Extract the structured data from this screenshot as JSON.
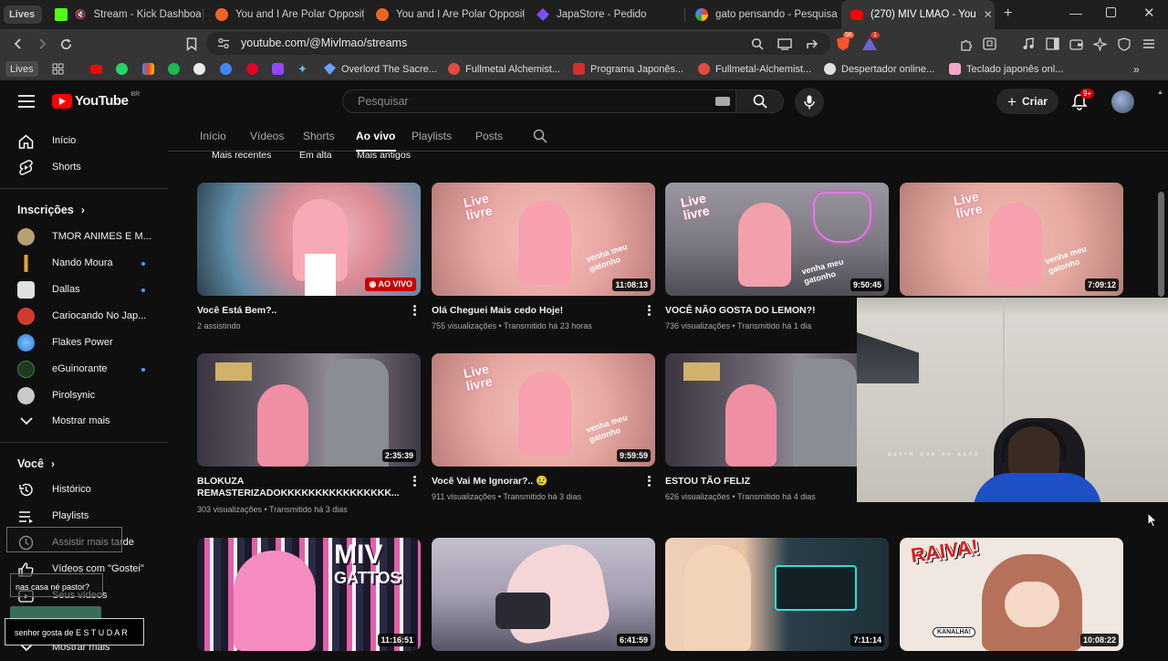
{
  "browser": {
    "tabs": [
      {
        "title": "Lives",
        "color": "#4a4a4a"
      },
      {
        "title": "Stream - Kick Dashboar",
        "color": "#53fc18"
      },
      {
        "title": "You and I Are Polar Opposit",
        "color": "#f16322"
      },
      {
        "title": "You and I Are Polar Opposit",
        "color": "#f16322"
      },
      {
        "title": "JapaStore - Pedido",
        "color": "#7b4dff"
      },
      {
        "title": "gato pensando - Pesquisa G",
        "color": "#ffffff"
      },
      {
        "title": "(270) MIV LMAO - You",
        "color": "#ff0000"
      }
    ],
    "url": "youtube.com/@Mivlmao/streams",
    "shield_badge": "1",
    "bookmarks": [
      {
        "label": "Lives"
      },
      {
        "label": "Overlord The Sacre..."
      },
      {
        "label": "Fullmetal Alchemist..."
      },
      {
        "label": "Programa Japonês..."
      },
      {
        "label": "Fullmetal-Alchemist..."
      },
      {
        "label": "Despertador online..."
      },
      {
        "label": "Teclado japonês onl..."
      }
    ]
  },
  "masthead": {
    "logo_text": "YouTube",
    "region": "BR",
    "search_placeholder": "Pesquisar",
    "create_label": "Criar",
    "notif_count": "9+"
  },
  "sidebar": {
    "home": "Início",
    "shorts": "Shorts",
    "subs_heading": "Inscrições",
    "subscriptions": [
      {
        "name": "TMOR ANIMES E M...",
        "color": "#b8a070",
        "dot": false
      },
      {
        "name": "Nando Moura",
        "color": "#0f0f0f",
        "dot": true
      },
      {
        "name": "Dallas",
        "color": "#e0e0e0",
        "dot": true
      },
      {
        "name": "Cariocando No Jap...",
        "color": "#d13b2e",
        "dot": false
      },
      {
        "name": "Flakes Power",
        "color": "#2b7bd8",
        "dot": false
      },
      {
        "name": "eGuinorante",
        "color": "#1f3a1f",
        "dot": true
      },
      {
        "name": "Pirolsynic",
        "color": "#c9c9c9",
        "dot": false
      }
    ],
    "show_more": "Mostrar mais",
    "you_heading": "Você",
    "you_items": [
      "Histórico",
      "Playlists",
      "Assistir mais tarde",
      "Vídeos com \"Gostei\"",
      "Seus vídeos",
      "Mostrar mais"
    ]
  },
  "channel_tabs": {
    "tabs": [
      "Início",
      "Vídeos",
      "Shorts",
      "Ao vivo",
      "Playlists",
      "Posts"
    ],
    "selected": "Ao vivo",
    "chips": [
      "Mais recentes",
      "Em alta",
      "Mais antigos"
    ]
  },
  "videos": [
    {
      "title": "Você Está Bem?..",
      "meta": "2 assistindo",
      "duration": "AO VIVO",
      "live": true,
      "bg": "#d98a94"
    },
    {
      "title": "Olá Cheguei Mais cedo Hoje!",
      "meta": "755 visualizações • Transmitido há 23 horas",
      "duration": "11:08:13",
      "live": false,
      "bg": "#e8a7a3"
    },
    {
      "title": "VOCÊ NÃO GOSTA DO LEMON?!",
      "meta": "736 visualizações • Transmitido há 1 dia",
      "duration": "9:50:45",
      "live": false,
      "bg": "#8a8790"
    },
    {
      "title": "",
      "meta": "",
      "duration": "7:09:12",
      "live": false,
      "bg": "#e5a9a0"
    },
    {
      "title": "BLOKUZA REMASTERIZADOKKKKKKKKKKKKKKKK...",
      "meta": "303 visualizações • Transmitido há 3 dias",
      "duration": "2:35:39",
      "live": false,
      "bg": "#5a5a66"
    },
    {
      "title": "Você Vai Me Ignorar?.. 😢",
      "meta": "911 visualizações • Transmitido há 3 dias",
      "duration": "9:59:59",
      "live": false,
      "bg": "#e6a8a2"
    },
    {
      "title": "ESTOU TÃO FELIZ",
      "meta": "626 visualizações • Transmitido há 4 dias",
      "duration": "",
      "live": false,
      "bg": "#55555f"
    },
    {
      "title": "",
      "meta": "",
      "duration": "",
      "live": false,
      "bg": "#ffffff"
    },
    {
      "title": "",
      "meta": "",
      "duration": "11:16:51",
      "live": false,
      "bg": "#c26b9b"
    },
    {
      "title": "",
      "meta": "",
      "duration": "6:41:59",
      "live": false,
      "bg": "#a59fb3"
    },
    {
      "title": "",
      "meta": "",
      "duration": "7:11:14",
      "live": false,
      "bg": "#6b7d8a"
    },
    {
      "title": "",
      "meta": "",
      "duration": "10:08:22",
      "live": false,
      "bg": "#efe7e0"
    }
  ],
  "thumb_text": {
    "live_livre": "Live livre",
    "venha": "venha meu gatonho",
    "miv": "MIV",
    "gattos": "GATTOS",
    "raiva": "RAIVA!",
    "kanalha": "KANALHA!"
  },
  "overlay": {
    "chat1": "nas casa né pastor?",
    "chat2": "senhor gosta de E S T U D A R",
    "cam_caption": "assim que eu acho"
  }
}
